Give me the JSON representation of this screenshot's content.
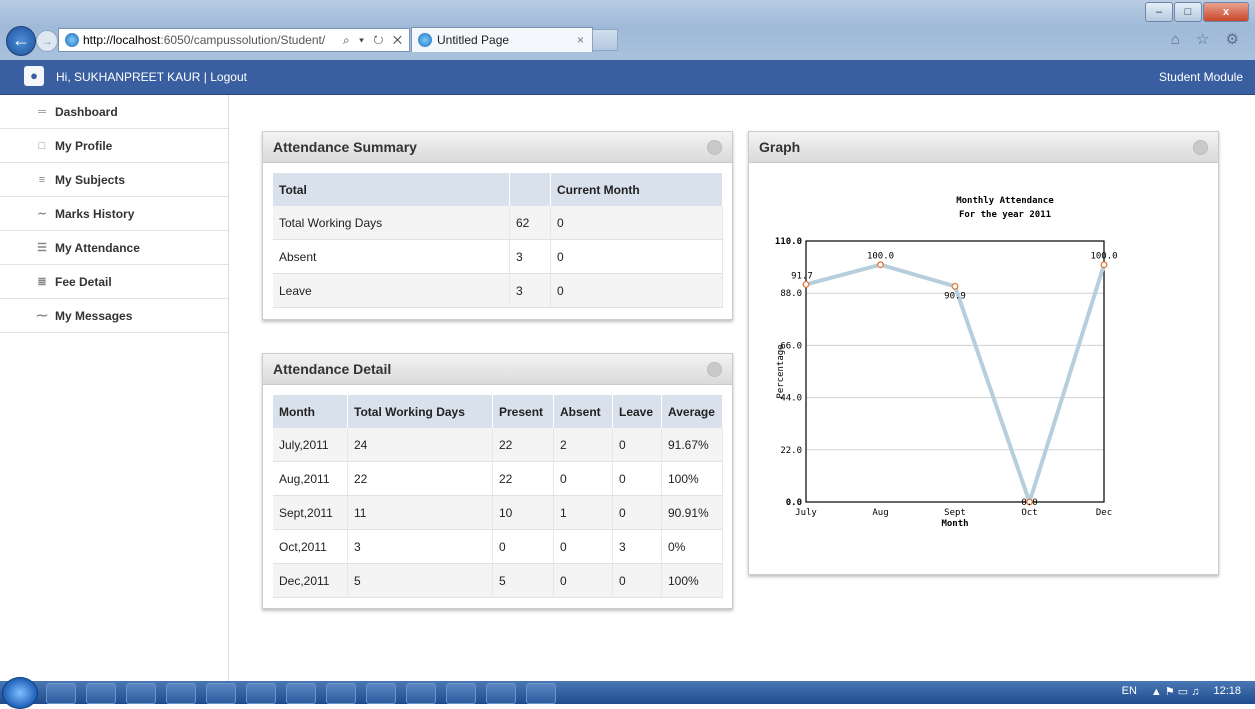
{
  "browser": {
    "url_host": "http://localhost",
    "url_rest": ":6050/campussolution/Student/",
    "tab_title": "Untitled Page",
    "controls": "⌕ ▾ ↻ ✕",
    "tools": "⌂ ☆ ⚙"
  },
  "header": {
    "greeting": "Hi, SUKHANPREET KAUR | Logout",
    "module": "Student Module"
  },
  "sidebar": {
    "items": [
      {
        "label": "Dashboard",
        "icon": "dashboard-icon",
        "glyph": "═"
      },
      {
        "label": "My Profile",
        "icon": "profile-icon",
        "glyph": "□"
      },
      {
        "label": "My Subjects",
        "icon": "subjects-icon",
        "glyph": "≡"
      },
      {
        "label": "Marks History",
        "icon": "chart-icon",
        "glyph": "∼"
      },
      {
        "label": "My Attendance",
        "icon": "list-icon",
        "glyph": "☰"
      },
      {
        "label": "Fee Detail",
        "icon": "fee-icon",
        "glyph": "≣"
      },
      {
        "label": "My Messages",
        "icon": "messages-icon",
        "glyph": "⁓"
      }
    ]
  },
  "summary": {
    "title": "Attendance Summary",
    "headers": [
      "Total",
      "",
      "Current Month"
    ],
    "rows": [
      [
        "Total Working Days",
        "62",
        "0"
      ],
      [
        "Absent",
        "3",
        "0"
      ],
      [
        "Leave",
        "3",
        "0"
      ]
    ]
  },
  "detail": {
    "title": "Attendance Detail",
    "headers": [
      "Month",
      "Total Working Days",
      "Present",
      "Absent",
      "Leave",
      "Average"
    ],
    "rows": [
      [
        "July,2011",
        "24",
        "22",
        "2",
        "0",
        "91.67%"
      ],
      [
        "Aug,2011",
        "22",
        "22",
        "0",
        "0",
        "100%"
      ],
      [
        "Sept,2011",
        "11",
        "10",
        "1",
        "0",
        "90.91%"
      ],
      [
        "Oct,2011",
        "3",
        "0",
        "0",
        "3",
        "0%"
      ],
      [
        "Dec,2011",
        "5",
        "5",
        "0",
        "0",
        "100%"
      ]
    ]
  },
  "graph": {
    "panel_title": "Graph"
  },
  "chart_data": {
    "type": "line",
    "title": "Monthly Attendance",
    "subtitle": "For the year 2011",
    "xlabel": "Month",
    "ylabel": "Percentage",
    "categories": [
      "July",
      "Aug",
      "Sept",
      "Oct",
      "Dec"
    ],
    "values": [
      91.7,
      100.0,
      90.9,
      0.0,
      100.0
    ],
    "value_labels": [
      "91.7",
      "100.0",
      "90.9",
      "0.0",
      "100.0"
    ],
    "yticks": [
      "0.0",
      "22.0",
      "44.0",
      "66.0",
      "88.0",
      "110.0"
    ],
    "ylim": [
      0,
      110
    ],
    "grid": true,
    "line_color": "#b7cedd",
    "marker_color": "#e07a3c"
  },
  "taskbar": {
    "lang": "EN",
    "clock": "12:18"
  }
}
